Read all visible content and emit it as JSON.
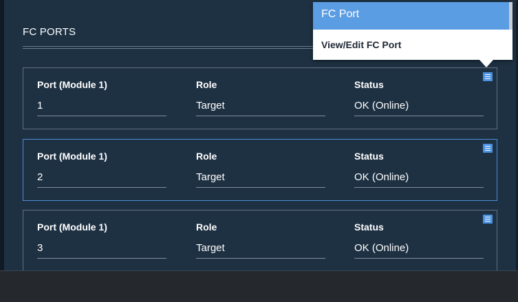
{
  "section": {
    "title": "FC PORTS"
  },
  "columns": {
    "port": "Port (Module 1)",
    "role": "Role",
    "status": "Status"
  },
  "ports": [
    {
      "port": "1",
      "role": "Target",
      "status": "OK (Online)",
      "selected": false
    },
    {
      "port": "2",
      "role": "Target",
      "status": "OK (Online)",
      "selected": true
    },
    {
      "port": "3",
      "role": "Target",
      "status": "OK (Online)",
      "selected": false
    }
  ],
  "popup": {
    "title": "FC Port",
    "item": "View/Edit FC Port"
  },
  "icons": {
    "card_menu": "hamburger-menu-icon"
  },
  "colors": {
    "accent": "#4b92e0",
    "popup_header": "#5b9de3",
    "background": "#1e3143"
  }
}
